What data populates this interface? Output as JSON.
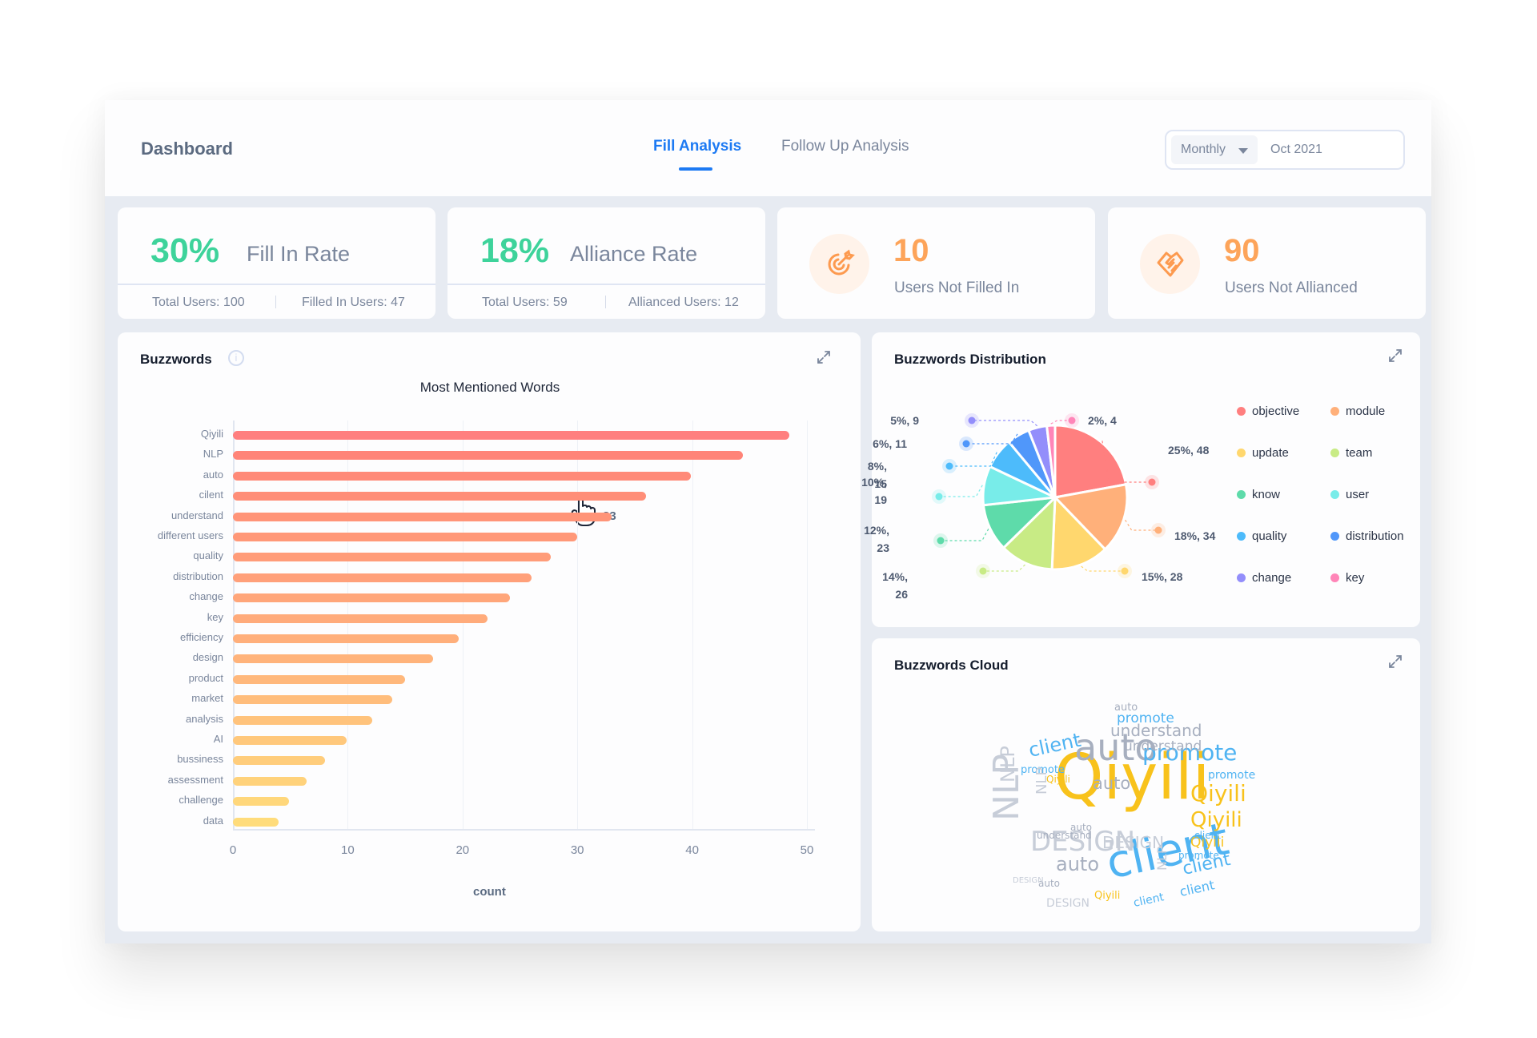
{
  "header": {
    "title": "Dashboard",
    "tabs": [
      {
        "label": "Fill Analysis",
        "active": true
      },
      {
        "label": "Follow Up Analysis",
        "active": false
      }
    ],
    "period_select": "Monthly",
    "period_value": "Oct 2021"
  },
  "stats": [
    {
      "value": "30%",
      "label": "Fill In Rate",
      "foot_left": "Total Users: 100",
      "foot_right": "Filled In Users: 47"
    },
    {
      "value": "18%",
      "label": "Alliance Rate",
      "foot_left": "Total Users: 59",
      "foot_right": "Allianced Users: 12"
    },
    {
      "value": "10",
      "label": "Users Not Filled In",
      "icon": "target-icon"
    },
    {
      "value": "90",
      "label": "Users Not Allianced",
      "icon": "handshake-icon"
    }
  ],
  "colors": {
    "accent": "#1d7af3",
    "rate_green": "#3ed39b",
    "count_orange": "#fda45a"
  },
  "buzzwords": {
    "title": "Buzzwords",
    "hover_value": "33"
  },
  "distribution": {
    "title": "Buzzwords Distribution"
  },
  "cloud": {
    "title": "Buzzwords Cloud",
    "words": [
      {
        "text": "Qiyili",
        "color": "#f8c21b",
        "weight": 5
      },
      {
        "text": "client",
        "color": "#4fb3f2",
        "weight": 4
      },
      {
        "text": "auto",
        "color": "#a7afbf",
        "weight": 3
      },
      {
        "text": "DESIGN",
        "color": "#c7cdd8",
        "weight": 3
      },
      {
        "text": "NLP",
        "color": "#c7cdd8",
        "weight": 3
      },
      {
        "text": "promote",
        "color": "#4fb3f2",
        "weight": 2
      },
      {
        "text": "understand",
        "color": "#a7afbf",
        "weight": 2
      }
    ]
  },
  "chart_data": [
    {
      "type": "bar",
      "orientation": "horizontal",
      "title": "Most Mentioned Words",
      "xlabel": "count",
      "ylabel": "",
      "xlim": [
        0,
        50
      ],
      "xticks": [
        0,
        10,
        20,
        30,
        40,
        50
      ],
      "grid": true,
      "categories": [
        "Qiyili",
        "NLP",
        "auto",
        "cilent",
        "understand",
        "different users",
        "quality",
        "distribution",
        "change",
        "key",
        "efficiency",
        "design",
        "product",
        "market",
        "analysis",
        "AI",
        "bussiness",
        "assessment",
        "challenge",
        "data"
      ],
      "values": [
        48.5,
        44.4,
        39.9,
        36,
        33,
        30,
        27.7,
        26,
        24.1,
        22.2,
        19.7,
        17.4,
        15,
        13.9,
        12.1,
        9.9,
        8,
        6.4,
        4.9,
        4
      ],
      "colors": [
        "#ff7f7f",
        "#ff8478",
        "#ff8a78",
        "#ff8e78",
        "#ff9478",
        "#ff9878",
        "#ff9c79",
        "#ffa07a",
        "#ffa67a",
        "#ffab7b",
        "#ffaf7b",
        "#ffb37b",
        "#ffb87c",
        "#ffbd7c",
        "#ffc37c",
        "#ffc87c",
        "#ffcd7c",
        "#ffd27b",
        "#ffd77b",
        "#ffdc7b"
      ]
    },
    {
      "type": "pie",
      "title": "Buzzwords Distribution",
      "legend_position": "right",
      "slices": [
        {
          "label": "objective",
          "value": 48,
          "percent": "25%",
          "color": "#ff7f7f"
        },
        {
          "label": "module",
          "value": 34,
          "percent": "18%",
          "color": "#ffb07a"
        },
        {
          "label": "update",
          "value": 28,
          "percent": "15%",
          "color": "#ffd76e"
        },
        {
          "label": "team",
          "value": 26,
          "percent": "14%",
          "color": "#c8eb85"
        },
        {
          "label": "know",
          "value": 23,
          "percent": "12%",
          "color": "#5edbaa"
        },
        {
          "label": "user",
          "value": 19,
          "percent": "10%",
          "color": "#78ece9"
        },
        {
          "label": "quality",
          "value": 15,
          "percent": "8%",
          "color": "#4dbbfb"
        },
        {
          "label": "distribution",
          "value": 11,
          "percent": "6%",
          "color": "#5097fa"
        },
        {
          "label": "change",
          "value": 9,
          "percent": "5%",
          "color": "#938efb"
        },
        {
          "label": "key",
          "value": 4,
          "percent": "2%",
          "color": "#ff85b8"
        }
      ]
    }
  ]
}
